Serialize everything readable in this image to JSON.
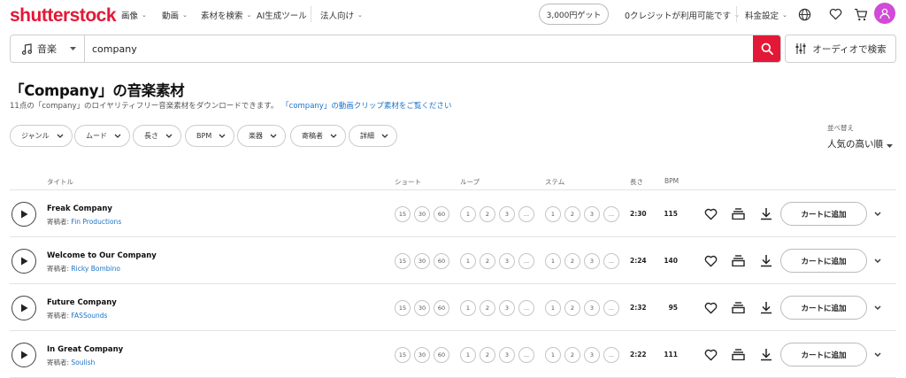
{
  "header": {
    "logo": "shutterstock",
    "nav": [
      "画像",
      "動画",
      "素材を検索",
      "AI生成ツール",
      "法人向け"
    ],
    "promo": "3,000円ゲット",
    "credits": "0クレジットが利用可能です",
    "pricing": "料金設定"
  },
  "search": {
    "type": "音楽",
    "query": "company",
    "audio_search": "オーディオで検索"
  },
  "page": {
    "title": "「Company」の音楽素材",
    "subtitle": "11点の「company」のロイヤリティフリー音楽素材をダウンロードできます。",
    "video_link": "「company」の動画クリップ素材をご覧ください"
  },
  "filters": [
    "ジャンル",
    "ムード",
    "長さ",
    "BPM",
    "楽器",
    "寄稿者",
    "詳細"
  ],
  "sort": {
    "label": "並べ替え",
    "value": "人気の高い順"
  },
  "table": {
    "headers": {
      "title": "タイトル",
      "short": "ショート",
      "loop": "ループ",
      "stem": "ステム",
      "length": "長さ",
      "bpm": "BPM"
    },
    "short_options": [
      "15",
      "30",
      "60"
    ],
    "loop_options": [
      "1",
      "2",
      "3",
      "..."
    ],
    "stem_options": [
      "1",
      "2",
      "3",
      "..."
    ],
    "author_prefix": "寄稿者:",
    "cart_label": "カートに追加",
    "rows": [
      {
        "title": "Freak Company",
        "author": "Fin Productions",
        "length": "2:30",
        "bpm": "115"
      },
      {
        "title": "Welcome to Our Company",
        "author": "Ricky Bombino",
        "length": "2:24",
        "bpm": "140"
      },
      {
        "title": "Future Company",
        "author": "FASSounds",
        "length": "2:32",
        "bpm": "95"
      },
      {
        "title": "In Great Company",
        "author": "Soulish",
        "length": "2:22",
        "bpm": "111"
      }
    ]
  },
  "colors": {
    "brand": "#e31837",
    "link": "#1a73c9",
    "avatar": "#d14bd8"
  }
}
